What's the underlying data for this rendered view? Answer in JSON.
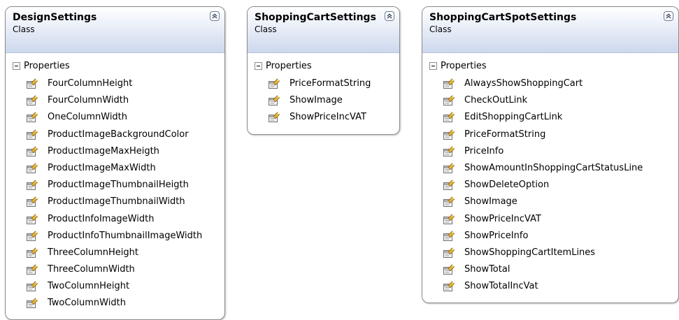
{
  "icons": {
    "collapse": "collapse-chevrons-icon",
    "expander": "minus-expander-icon",
    "property": "property-icon"
  },
  "colors": {
    "header_top": "#ffffff",
    "header_bottom": "#cdd8ee",
    "border": "#8a8a8a"
  },
  "classes": [
    {
      "name": "DesignSettings",
      "kind": "Class",
      "section": "Properties",
      "properties": [
        "FourColumnHeight",
        "FourColumnWidth",
        "OneColumnWidth",
        "ProductImageBackgroundColor",
        "ProductImageMaxHeigth",
        "ProductImageMaxWidth",
        "ProductImageThumbnailHeigth",
        "ProductImageThumbnailWidth",
        "ProductInfoImageWidth",
        "ProductInfoThumbnailImageWidth",
        "ThreeColumnHeight",
        "ThreeColumnWidth",
        "TwoColumnHeight",
        "TwoColumnWidth"
      ]
    },
    {
      "name": "ShoppingCartSettings",
      "kind": "Class",
      "section": "Properties",
      "properties": [
        "PriceFormatString",
        "ShowImage",
        "ShowPriceIncVAT"
      ]
    },
    {
      "name": "ShoppingCartSpotSettings",
      "kind": "Class",
      "section": "Properties",
      "properties": [
        "AlwaysShowShoppingCart",
        "CheckOutLink",
        "EditShoppingCartLink",
        "PriceFormatString",
        "PriceInfo",
        "ShowAmountInShoppingCartStatusLine",
        "ShowDeleteOption",
        "ShowImage",
        "ShowPriceIncVAT",
        "ShowPriceInfo",
        "ShowShoppingCartItemLines",
        "ShowTotal",
        "ShowTotalIncVat"
      ]
    }
  ]
}
